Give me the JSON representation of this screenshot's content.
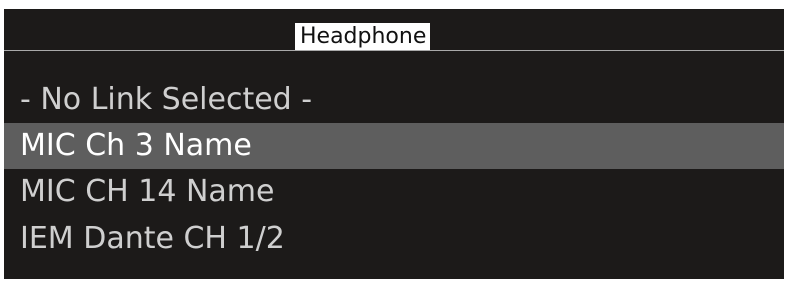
{
  "header": {
    "title": "Headphone"
  },
  "list": {
    "items": [
      {
        "label": "- No Link Selected -",
        "selected": false
      },
      {
        "label": "MIC Ch 3 Name",
        "selected": true
      },
      {
        "label": "MIC CH 14 Name",
        "selected": false
      },
      {
        "label": "IEM Dante CH 1/2",
        "selected": false
      }
    ]
  },
  "colors": {
    "background": "#1c1a19",
    "selected_row": "#5e5e5e",
    "text": "#cfcfcf",
    "title_bg": "#ffffff"
  }
}
